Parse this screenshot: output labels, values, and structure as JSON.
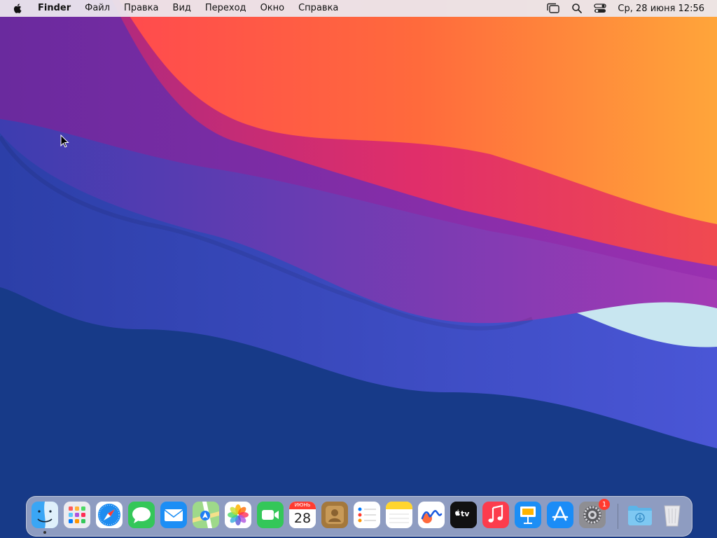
{
  "menubar": {
    "apple_icon": "apple-icon",
    "app_name": "Finder",
    "items": [
      "Файл",
      "Правка",
      "Вид",
      "Переход",
      "Окно",
      "Справка"
    ],
    "status_icons": [
      "stage-manager-icon",
      "search-icon",
      "control-center-icon"
    ],
    "clock": "Ср, 28 июня  12:56"
  },
  "dock": {
    "apps": [
      {
        "name": "Finder",
        "icon": "finder-icon",
        "running": true
      },
      {
        "name": "Launchpad",
        "icon": "launchpad-icon"
      },
      {
        "name": "Safari",
        "icon": "safari-icon"
      },
      {
        "name": "Messages",
        "icon": "messages-icon"
      },
      {
        "name": "Mail",
        "icon": "mail-icon"
      },
      {
        "name": "Maps",
        "icon": "maps-icon"
      },
      {
        "name": "Photos",
        "icon": "photos-icon"
      },
      {
        "name": "FaceTime",
        "icon": "facetime-icon"
      },
      {
        "name": "Calendar",
        "icon": "calendar-icon",
        "month": "ИЮНЬ",
        "day": "28"
      },
      {
        "name": "Contacts",
        "icon": "contacts-icon"
      },
      {
        "name": "Reminders",
        "icon": "reminders-icon"
      },
      {
        "name": "Notes",
        "icon": "notes-icon"
      },
      {
        "name": "Freeform",
        "icon": "freeform-icon"
      },
      {
        "name": "TV",
        "icon": "tv-icon",
        "label": "tv"
      },
      {
        "name": "Music",
        "icon": "music-icon"
      },
      {
        "name": "Keynote",
        "icon": "keynote-icon"
      },
      {
        "name": "App Store",
        "icon": "app-store-icon"
      },
      {
        "name": "System Settings",
        "icon": "system-settings-icon",
        "badge": "1"
      }
    ],
    "right": [
      {
        "name": "Downloads",
        "icon": "downloads-folder-icon"
      },
      {
        "name": "Trash",
        "icon": "trash-icon"
      }
    ]
  },
  "colors": {
    "wallpaper_orange": "#ff8a3a",
    "wallpaper_magenta": "#d92f6e",
    "wallpaper_purple": "#7a2fa0",
    "wallpaper_blue": "#2a46a8",
    "wallpaper_navy": "#173a88"
  }
}
